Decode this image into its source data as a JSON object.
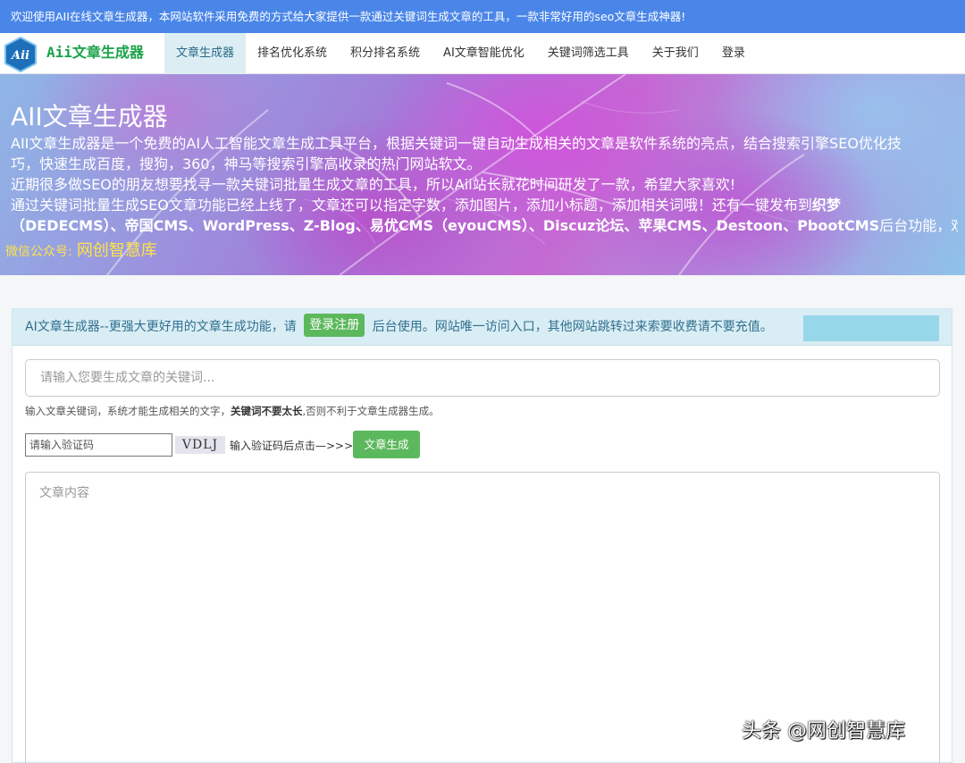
{
  "topbar": {
    "text": "欢迎使用AII在线文章生成器，本网站软件采用免费的方式给大家提供一款通过关键词生成文章的工具，一款非常好用的seo文章生成神器!"
  },
  "brand": {
    "logo_text": "Aii",
    "name": "Aii文章生成器"
  },
  "nav": {
    "items": [
      {
        "label": "文章生成器",
        "active": true
      },
      {
        "label": "排名优化系统"
      },
      {
        "label": "积分排名系统"
      },
      {
        "label": "AI文章智能优化"
      },
      {
        "label": "关键词筛选工具"
      },
      {
        "label": "关于我们"
      },
      {
        "label": "登录"
      }
    ]
  },
  "hero": {
    "title": "AII文章生成器",
    "line1": "AII文章生成器是一个免费的AI人工智能文章生成工具平台，根据关键词一键自动生成相关的文章是软件系统的亮点，结合搜索引擎SEO优化技",
    "line2": "巧，快速生成百度，搜狗，360，神马等搜索引擎高收录的热门网站软文。",
    "line3": "近期很多做SEO的朋友想要找寻一款关键词批量生成文章的工具，所以Aii站长就花时间研发了一款，希望大家喜欢!",
    "line4": "通过关键词批量生成SEO文章功能已经上线了，文章还可以指定字数，添加图片，添加小标题，添加相关词哦！还有一键发布到",
    "line4_bold": "织梦",
    "line5_bold": "（DEDECMS）、帝国CMS、WordPress、Z-Blog、易优CMS（eyouCMS）、Discuz论坛、苹果CMS、Destoon、PbootCMS",
    "line5_tail": "后台功能，欢",
    "wechat_label": "微信公众号:",
    "wechat_value": "网创智慧库"
  },
  "notice": {
    "before": "AI文章生成器--更强大更好用的文章生成功能，请",
    "login_button": "登录注册",
    "after": "后台使用。网站唯一访问入口，其他网站跳转过来索要收费请不要充值。"
  },
  "form": {
    "keyword_placeholder": "请输入您要生成文章的关键词...",
    "hint_before": "输入文章关键词，系统才能生成相关的文字，",
    "hint_bold": "关键词不要太长",
    "hint_after": ",否则不利于文章生成器生成。",
    "captcha_placeholder": "请输入验证码",
    "captcha_code": "VDLJ",
    "captcha_tip": "输入验证码后点击—>>>",
    "generate_button": "文章生成",
    "content_placeholder": "文章内容"
  },
  "watermark": "头条 @网创智慧库",
  "colors": {
    "topbar": "#4a86e8",
    "nav_active_bg": "#dceef3",
    "notice_bg": "#d9edf4",
    "button_green": "#5cb85c",
    "wechat_yellow": "#ffe24a"
  }
}
